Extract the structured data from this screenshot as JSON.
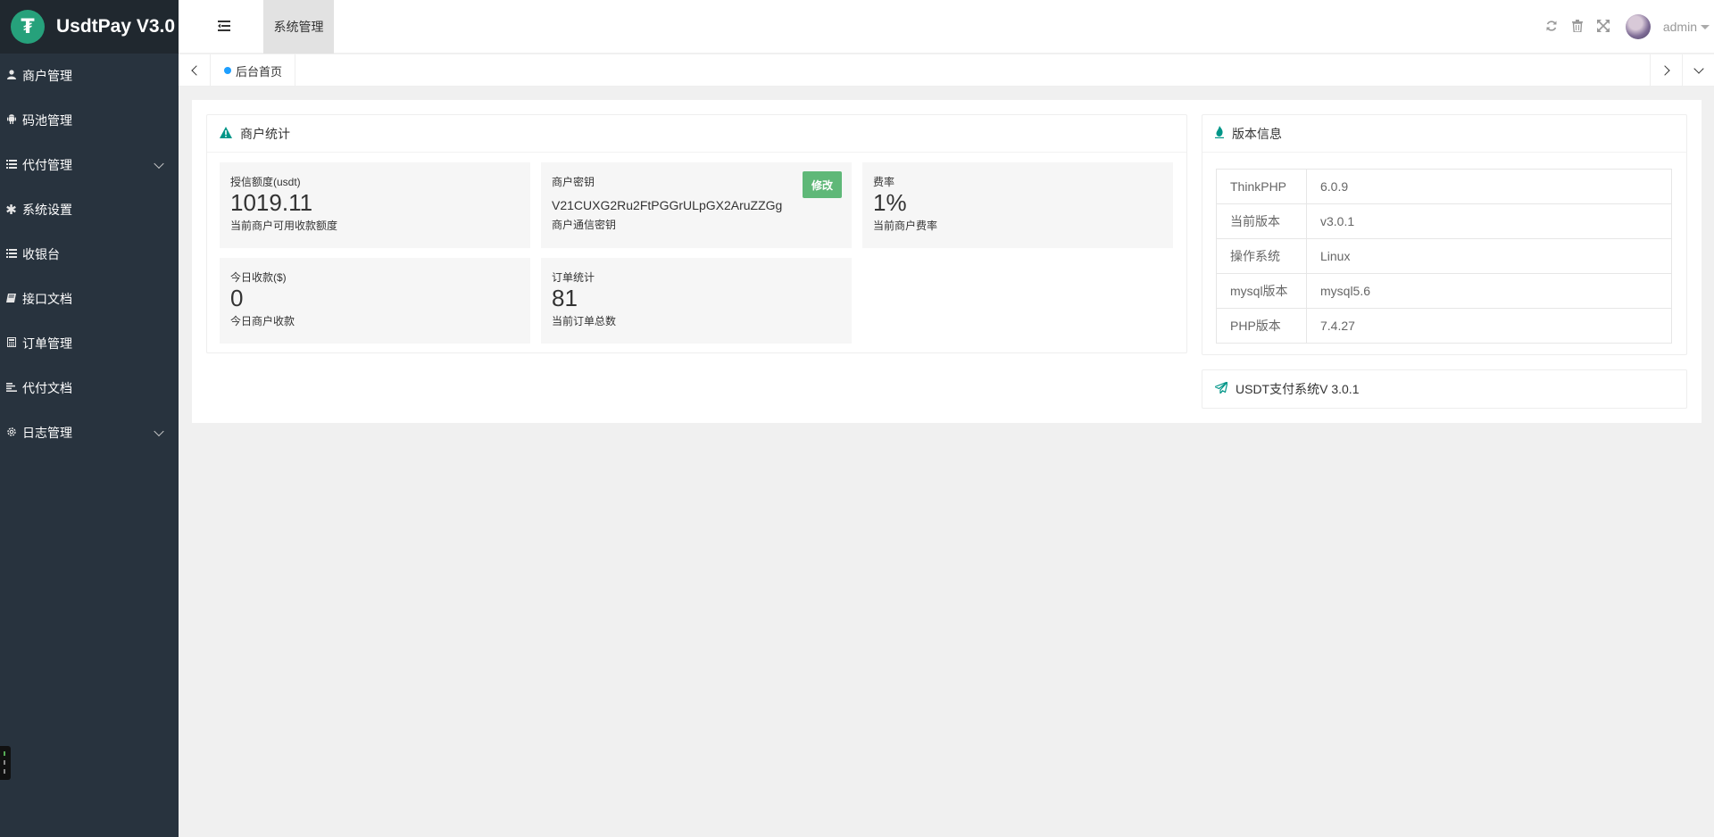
{
  "app": {
    "logo_glyph": "₮",
    "title": "UsdtPay V3.0"
  },
  "sidebar": {
    "items": [
      {
        "icon": "user-icon",
        "label": "商户管理",
        "expandable": false
      },
      {
        "icon": "android-icon",
        "label": "码池管理",
        "expandable": false
      },
      {
        "icon": "list-icon",
        "label": "代付管理",
        "expandable": true
      },
      {
        "icon": "asterisk-icon",
        "label": "系统设置",
        "expandable": false
      },
      {
        "icon": "list-icon",
        "label": "收银台",
        "expandable": false
      },
      {
        "icon": "book-icon",
        "label": "接口文档",
        "expandable": false
      },
      {
        "icon": "calculator-icon",
        "label": "订单管理",
        "expandable": false
      },
      {
        "icon": "align-left-icon",
        "label": "代付文档",
        "expandable": false
      },
      {
        "icon": "gear-icon",
        "label": "日志管理",
        "expandable": true
      }
    ]
  },
  "header": {
    "active_tab": "系统管理",
    "user_name": "admin"
  },
  "tabbar": {
    "home_tab": "后台首页"
  },
  "stats_panel": {
    "title": "商户统计",
    "cards": [
      {
        "title": "授信额度(usdt)",
        "value": "1019.11",
        "desc": "当前商户可用收款额度"
      },
      {
        "title": "商户密钥",
        "value": "V21CUXG2Ru2FtPGGrULpGX2AruZZGg",
        "desc": "商户通信密钥",
        "button": "修改"
      },
      {
        "title": "费率",
        "value": "1%",
        "desc": "当前商户费率"
      },
      {
        "title": "今日收款($)",
        "value": "0",
        "desc": "今日商户收款"
      },
      {
        "title": "订单统计",
        "value": "81",
        "desc": "当前订单总数"
      }
    ]
  },
  "version_panel": {
    "title": "版本信息",
    "rows": [
      {
        "key": "ThinkPHP",
        "value": "6.0.9"
      },
      {
        "key": "当前版本",
        "value": "v3.0.1"
      },
      {
        "key": "操作系统",
        "value": "Linux"
      },
      {
        "key": "mysql版本",
        "value": "mysql5.6"
      },
      {
        "key": "PHP版本",
        "value": "7.4.27"
      }
    ]
  },
  "footer_panel": {
    "text": "USDT支付系统V 3.0.1"
  },
  "colors": {
    "sidebar_bg": "#28333e",
    "logo_bg": "#20282f",
    "logo_accent": "#26a17b",
    "edit_button": "#5fb878",
    "tab_dot": "#1e9fff",
    "panel_icon": "#009688"
  }
}
